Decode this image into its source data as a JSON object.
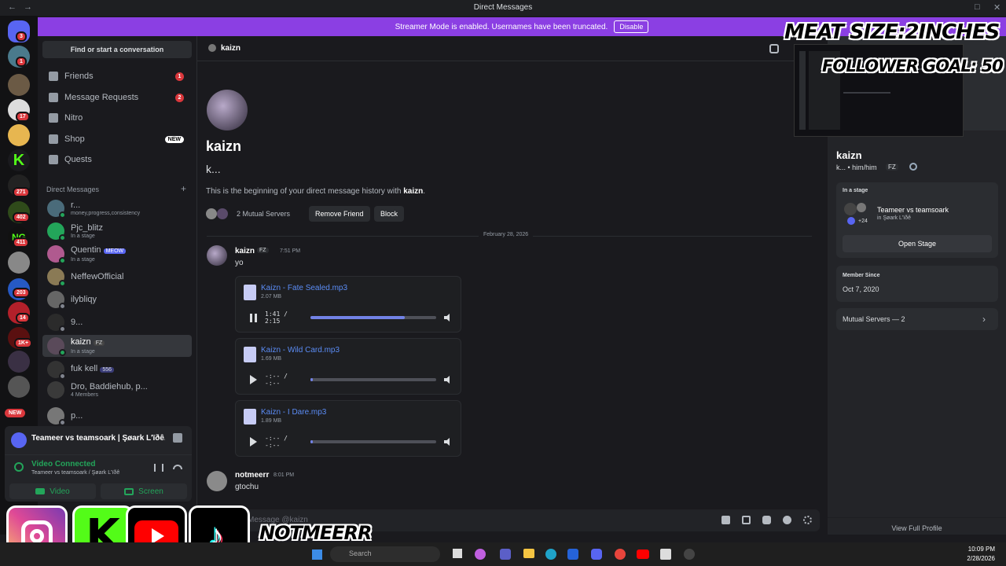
{
  "titlebar": {
    "title": "Direct Messages"
  },
  "banner": {
    "text": "Streamer Mode is enabled. Usernames have been truncated.",
    "button": "Disable"
  },
  "guild_badges": [
    "3",
    "1",
    "17",
    "271",
    "402",
    "411",
    "203",
    "14",
    "1K+"
  ],
  "guild_new": "NEW",
  "sidebar": {
    "search_label": "Find or start a conversation",
    "nav": [
      {
        "label": "Friends",
        "badge": "1"
      },
      {
        "label": "Message Requests",
        "badge": "2"
      },
      {
        "label": "Nitro"
      },
      {
        "label": "Shop",
        "tag": "NEW"
      },
      {
        "label": "Quests"
      }
    ],
    "dm_header": "Direct Messages",
    "dms": [
      {
        "name": "r...",
        "sub": "money,progress,consistency"
      },
      {
        "name": "Pjc_blitz",
        "sub": "In a stage"
      },
      {
        "name": "Quentin",
        "tag": "MEOW",
        "sub": "In a stage"
      },
      {
        "name": "NeffewOfficial",
        "sub": ""
      },
      {
        "name": "ilybliqy",
        "sub": ""
      },
      {
        "name": "9...",
        "sub": ""
      },
      {
        "name": "kaizn",
        "tag": "FZ",
        "sub": "In a stage"
      },
      {
        "name": "fuk kell",
        "tag": "556",
        "sub": ""
      },
      {
        "name": "Dro, Baddiehub, p...",
        "sub": "4 Members"
      },
      {
        "name": "p...",
        "sub": ""
      }
    ]
  },
  "voice": {
    "stage_title": "Teameer vs teamsoark | Şøark L'ïðê...",
    "status": "Video Connected",
    "channel": "Teameer vs teamsoark / Şøark L'ïðê",
    "video_label": "Video",
    "screen_label": "Screen"
  },
  "chat": {
    "header_name": "kaizn",
    "intro_name": "kaizn",
    "intro_sub": "k...",
    "intro_text_pre": "This is the beginning of your direct message history with ",
    "intro_text_name": "kaizn",
    "intro_text_post": ".",
    "mutual": "2 Mutual Servers",
    "remove_friend": "Remove Friend",
    "block": "Block",
    "date_divider": "February 28, 2026",
    "messages": [
      {
        "author": "kaizn",
        "tag": "FZ",
        "time": "7:51 PM",
        "text": "yo"
      },
      {
        "author": "notmeerr",
        "time": "8:01 PM",
        "text": "gtochu"
      }
    ],
    "attachments": [
      {
        "name": "Kaizn - Fate Sealed.mp3",
        "size": "2.07 MB",
        "time": "1:41 / 2:15",
        "progress": 0.75,
        "playing": true
      },
      {
        "name": "Kaizn - Wild Card.mp3",
        "size": "1.69 MB",
        "time": "-:-- / -:--",
        "progress": 0.02,
        "playing": false
      },
      {
        "name": "Kaizn - I Dare.mp3",
        "size": "1.89 MB",
        "time": "-:-- / -:--",
        "progress": 0.02,
        "playing": false
      }
    ],
    "input_placeholder": "Message @kaizn"
  },
  "profile": {
    "name": "kaizn",
    "pronouns": "k... • him/him",
    "tag": "FZ",
    "in_stage_label": "In a stage",
    "stage_name": "Teameer vs teamsoark",
    "stage_where": "in Şøark L'ïðê",
    "stage_count": "+24",
    "open_stage": "Open Stage",
    "member_since_label": "Member Since",
    "member_since": "Oct 7, 2020",
    "mutual_servers": "Mutual Servers — 2",
    "view_full": "View Full Profile"
  },
  "overlay": {
    "line1": "MEAT SIZE:2INCHES",
    "line2": "FOLLOWER GOAL: 50",
    "handle": "NOTMEERR"
  },
  "taskbar": {
    "search": "Search",
    "time": "10:09 PM",
    "date": "2/28/2026"
  }
}
